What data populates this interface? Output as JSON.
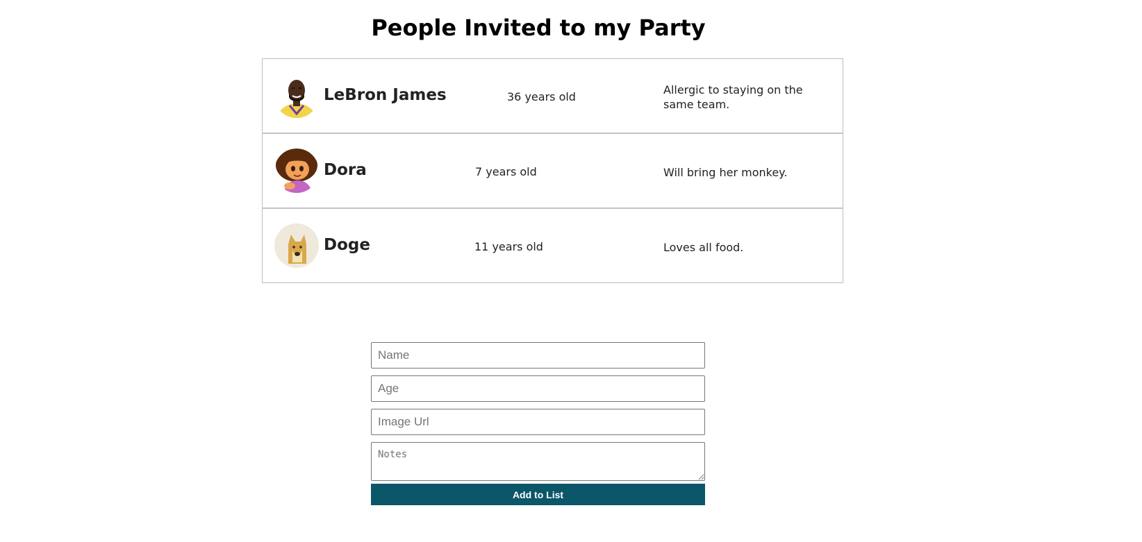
{
  "page": {
    "title": "People Invited to my Party"
  },
  "guests": [
    {
      "name": "LeBron James",
      "age": "36 years old",
      "note": "Allergic to staying on the same team.",
      "avatar": "lebron-avatar"
    },
    {
      "name": "Dora",
      "age": "7 years old",
      "note": "Will bring her monkey.",
      "avatar": "dora-avatar"
    },
    {
      "name": "Doge",
      "age": "11 years old",
      "note": "Loves all food.",
      "avatar": "doge-avatar"
    }
  ],
  "form": {
    "name_placeholder": "Name",
    "age_placeholder": "Age",
    "image_placeholder": "Image Url",
    "notes_placeholder": "Notes",
    "submit_label": "Add to List"
  },
  "colors": {
    "button": "#0b5669",
    "border": "#bdbdbd"
  }
}
